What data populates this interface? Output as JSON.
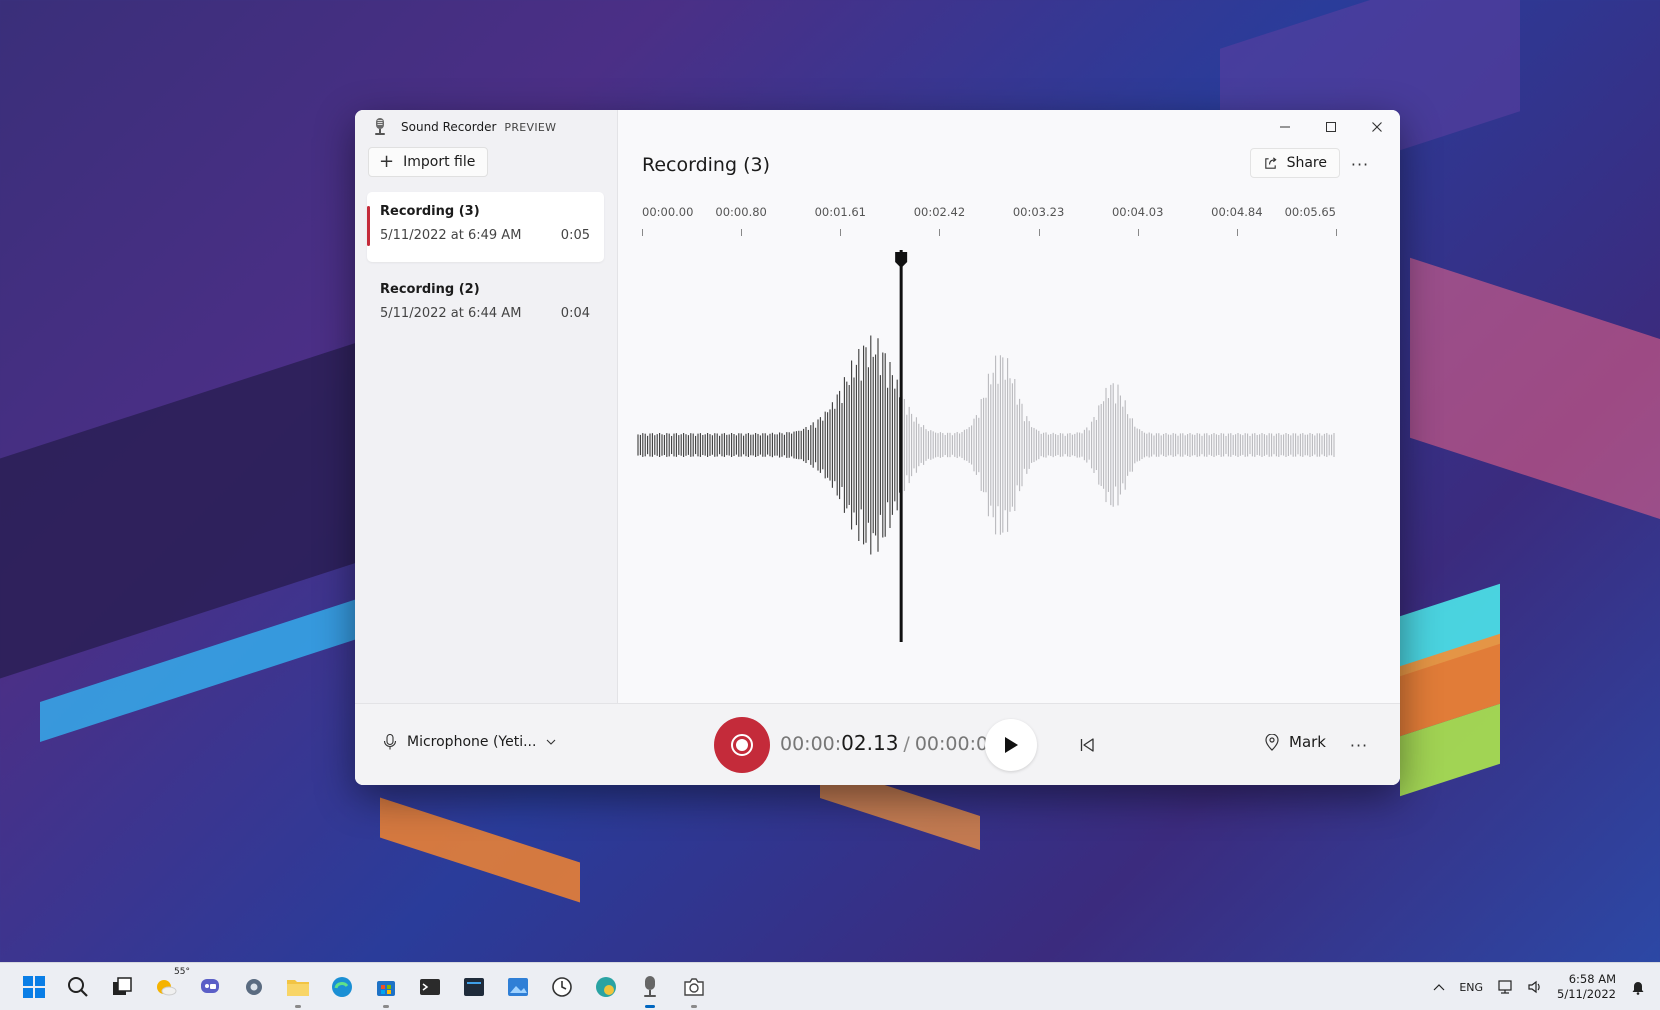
{
  "window": {
    "app_title": "Sound Recorder",
    "app_badge": "PREVIEW",
    "controls": {
      "minimize": "minimize",
      "maximize": "maximize",
      "close": "close"
    }
  },
  "sidebar": {
    "import_label": "Import file",
    "recordings": [
      {
        "name": "Recording (3)",
        "date": "5/11/2022 at 6:49 AM",
        "duration": "0:05",
        "selected": true
      },
      {
        "name": "Recording (2)",
        "date": "5/11/2022 at 6:44 AM",
        "duration": "0:04",
        "selected": false
      }
    ]
  },
  "main": {
    "title": "Recording (3)",
    "share_label": "Share",
    "more_label": "···",
    "timeline_ticks": [
      "00:00.00",
      "00:00.80",
      "00:01.61",
      "00:02.42",
      "00:03.23",
      "00:04.03",
      "00:04.84",
      "00:05.65"
    ],
    "playhead_fraction": 0.377
  },
  "bottombar": {
    "microphone_label": "Microphone (Yeti...",
    "time_prefix": "00:00:",
    "time_current": "02.13",
    "time_separator": "/",
    "time_total": "00:00:05",
    "mark_label": "Mark",
    "more_label": "···"
  },
  "taskbar": {
    "weather_temp": "55°",
    "language": "ENG",
    "time": "6:58 AM",
    "date": "5/11/2022",
    "icons": [
      "start-icon",
      "search-icon",
      "task-view-icon",
      "widgets-icon",
      "chat-icon",
      "settings-icon",
      "file-explorer-icon",
      "edge-icon",
      "store-icon",
      "terminal-icon",
      "app-icon",
      "photos-icon",
      "clock-icon",
      "edge-canary-icon",
      "sound-recorder-icon",
      "camera-icon"
    ]
  },
  "colors": {
    "accent_red": "#c42b3a",
    "taskbar_active": "#0067c0",
    "window_bg": "#f9f9fb",
    "sidebar_bg": "#f1f1f4"
  }
}
